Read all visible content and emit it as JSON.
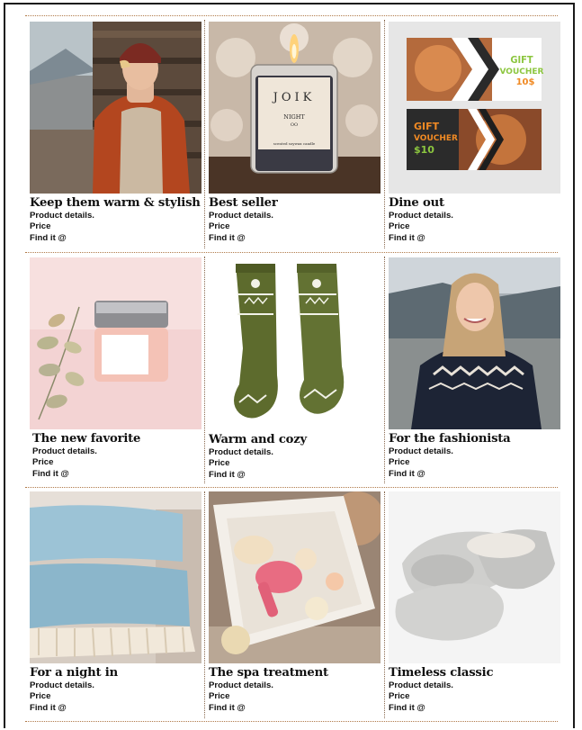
{
  "products": [
    {
      "title": "Keep them warm & stylish",
      "details": "Product details.",
      "price": "Price",
      "find": "Find it @",
      "image": "man-in-red-puffer-jacket"
    },
    {
      "title": "Best seller",
      "details": "Product details.",
      "price": "Price",
      "find": "Find it @",
      "image": "candle-jar",
      "image_text": {
        "brand": "JOIK",
        "name": "NIGHT",
        "sub": "OO",
        "foot": "scented soywax candle"
      }
    },
    {
      "title": "Dine out",
      "details": "Product details.",
      "price": "Price",
      "find": "Find it @",
      "image": "gift-voucher-cards",
      "image_text": {
        "v1_line1": "GIFT",
        "v1_line2": "VOUCHER",
        "v1_amount": "10$",
        "v2_line1": "GIFT",
        "v2_line2": "VOUCHER",
        "v2_amount": "$10"
      }
    },
    {
      "title": "The new favorite",
      "details": "Product details.",
      "price": "Price",
      "find": "Find it @",
      "image": "cream-jar-with-eucalyptus"
    },
    {
      "title": "Warm and cozy",
      "details": "Product details.",
      "price": "Price",
      "find": "Find it @",
      "image": "green-wool-socks"
    },
    {
      "title": "For the fashionista",
      "details": "Product details.",
      "price": "Price",
      "find": "Find it @",
      "image": "woman-in-nordic-sweater"
    },
    {
      "title": "For a night in",
      "details": "Product details.",
      "price": "Price",
      "find": "Find it @",
      "image": "folded-blue-blankets"
    },
    {
      "title": "The spa treatment",
      "details": "Product details.",
      "price": "Price",
      "find": "Find it @",
      "image": "spa-gift-box"
    },
    {
      "title": "Timeless classic",
      "details": "Product details.",
      "price": "Price",
      "find": "Find it @",
      "image": "grey-slippers"
    }
  ],
  "colors": {
    "rule": "#b07a4a",
    "border": "#1a1a1a",
    "text": "#111111"
  }
}
